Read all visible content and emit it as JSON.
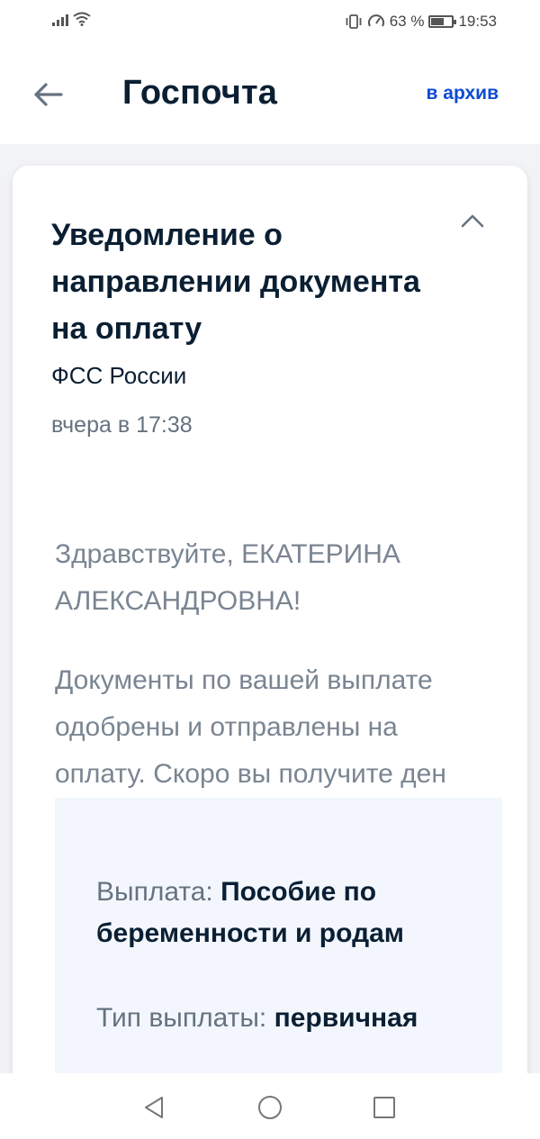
{
  "status_bar": {
    "battery_percent": "63 %",
    "battery_level": 0.63,
    "time": "19:53",
    "icons": [
      "signal-icon",
      "wifi-icon",
      "vibrate-icon",
      "data-saver-icon",
      "battery-icon"
    ]
  },
  "header": {
    "title": "Госпочта",
    "archive_label": "в архив",
    "back_icon": "arrow-left-icon"
  },
  "notice": {
    "title": "Уведомление о направлении документа на оплату",
    "sender": "ФСС России",
    "date": "вчера в 17:38",
    "collapse_icon": "chevron-up-icon",
    "greeting": "Здравствуйте, ЕКАТЕРИНА АЛЕКСАНДРОВНА!",
    "message_lines": [
      "Документы по вашей выплате",
      "одобрены и отправлены на",
      "оплату. Скоро вы получите ден"
    ],
    "details": [
      {
        "label": "Выплата: ",
        "value": "Пособие по беременности и родам"
      },
      {
        "label": "Тип выплаты: ",
        "value": "первичная"
      }
    ]
  },
  "colors": {
    "accent": "#0d4cd3",
    "text_primary": "#0b1f33",
    "text_secondary": "#66727f",
    "info_background": "#f3f7fd"
  },
  "nav_bar": {
    "icons": [
      "nav-back-icon",
      "nav-home-icon",
      "nav-recents-icon"
    ]
  }
}
